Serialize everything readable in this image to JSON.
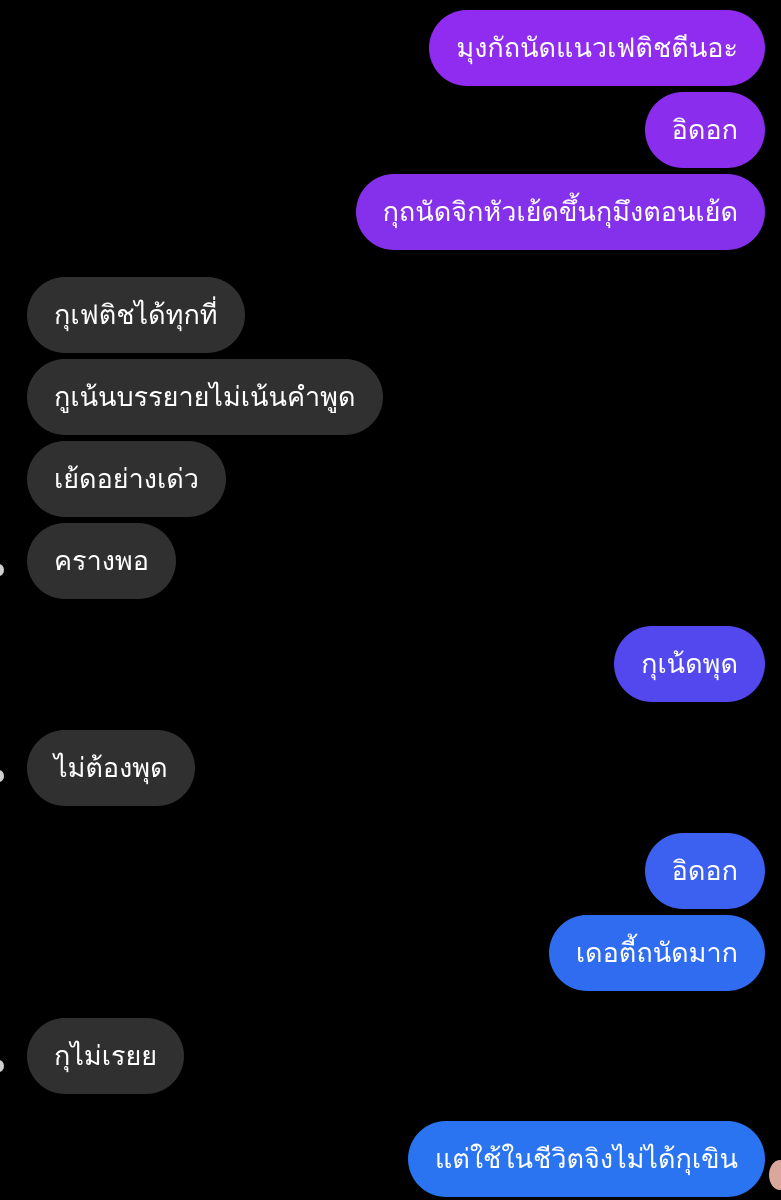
{
  "colors": {
    "background": "#000000",
    "incoming_bubble": "#303030",
    "outgoing_purple": "#8a2be2",
    "outgoing_indigo": "#4f52f0",
    "outgoing_blue": "#2f6ef0",
    "text": "#ffffff"
  },
  "messages": [
    {
      "text": "มุงกัถนัดแนวเฟติชตีนอะ",
      "direction": "outgoing",
      "color": "#8f2cf0"
    },
    {
      "text": "อิดอก",
      "direction": "outgoing",
      "color": "#8b2ded"
    },
    {
      "text": "กุถนัดจิกหัวเย้ดขึ้นกุมึงตอนเย้ด",
      "direction": "outgoing",
      "color": "#8530ea"
    },
    {
      "text": "กุเฟติชได้ทุกที่",
      "direction": "incoming",
      "color": "#303030"
    },
    {
      "text": "กูเน้นบรรยายไม่เน้นคำพูด",
      "direction": "incoming",
      "color": "#303030"
    },
    {
      "text": "เย้ดอย่างเด่ว",
      "direction": "incoming",
      "color": "#303030"
    },
    {
      "text": "ครางพอ",
      "direction": "incoming",
      "color": "#303030"
    },
    {
      "text": "กุเน้ดพุด",
      "direction": "outgoing",
      "color": "#5248ee"
    },
    {
      "text": "ไม่ต้องพุด",
      "direction": "incoming",
      "color": "#303030"
    },
    {
      "text": "อิดอก",
      "direction": "outgoing",
      "color": "#3c60ef"
    },
    {
      "text": "เดอตี้ถนัดมาก",
      "direction": "outgoing",
      "color": "#2f6cf0"
    },
    {
      "text": "กุไม่เรยย",
      "direction": "incoming",
      "color": "#303030"
    },
    {
      "text": "แต่ใช้ในชีวิตจิงไม่ได้กุเขิน",
      "direction": "outgoing",
      "color": "#2a74f2"
    }
  ]
}
